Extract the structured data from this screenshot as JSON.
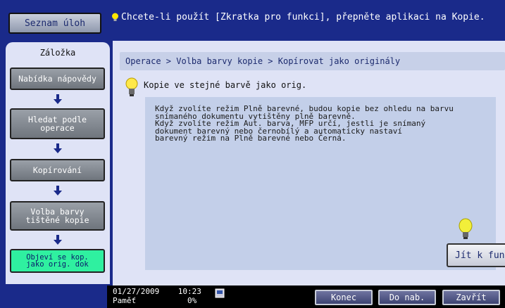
{
  "header": {
    "task_list_label": "Seznam úloh",
    "message": "Chcete-li použít [Zkratka pro funkci], přepněte aplikaci na Kopie."
  },
  "sidebar": {
    "title": "Záložka",
    "items": [
      {
        "label": "Nabídka nápovědy"
      },
      {
        "label": "Hledat podle operace"
      },
      {
        "label": "Kopírování"
      },
      {
        "label": "Volba barvy tištěné kopie"
      },
      {
        "label": "Objeví se kop. jako orig. dok"
      }
    ]
  },
  "main": {
    "breadcrumb": "Operace > Volba barvy kopie > Kopírovat jako originály",
    "hint_title": "Kopie ve stejné barvě jako orig.",
    "description": "Když zvolíte režim Plně barevné, budou kopie bez ohledu na barvu\nsnímaného dokumentu vytištěny plně barevně.\nKdyž zvolíte režim Aut. barva, MFP určí, jestli je snímaný\ndokument barevný nebo černobílý a automaticky nastaví\nbarevný režim na Plně barevné nebo Černá.",
    "goto_label": "Jít k funkci"
  },
  "footer": {
    "date": "01/27/2009",
    "time": "10:23",
    "memory_label": "Paměť",
    "memory_value": "0%",
    "end_label": "Konec",
    "back_label": "Do nab.",
    "close_label": "Zavřít"
  },
  "colors": {
    "brand_blue": "#1a2a8a",
    "panel_bg": "#dfe3f6",
    "active_green": "#2ff0a0"
  },
  "icons": [
    "lightbulb-icon",
    "arrow-down-icon",
    "lamp-icon",
    "network-icon"
  ]
}
